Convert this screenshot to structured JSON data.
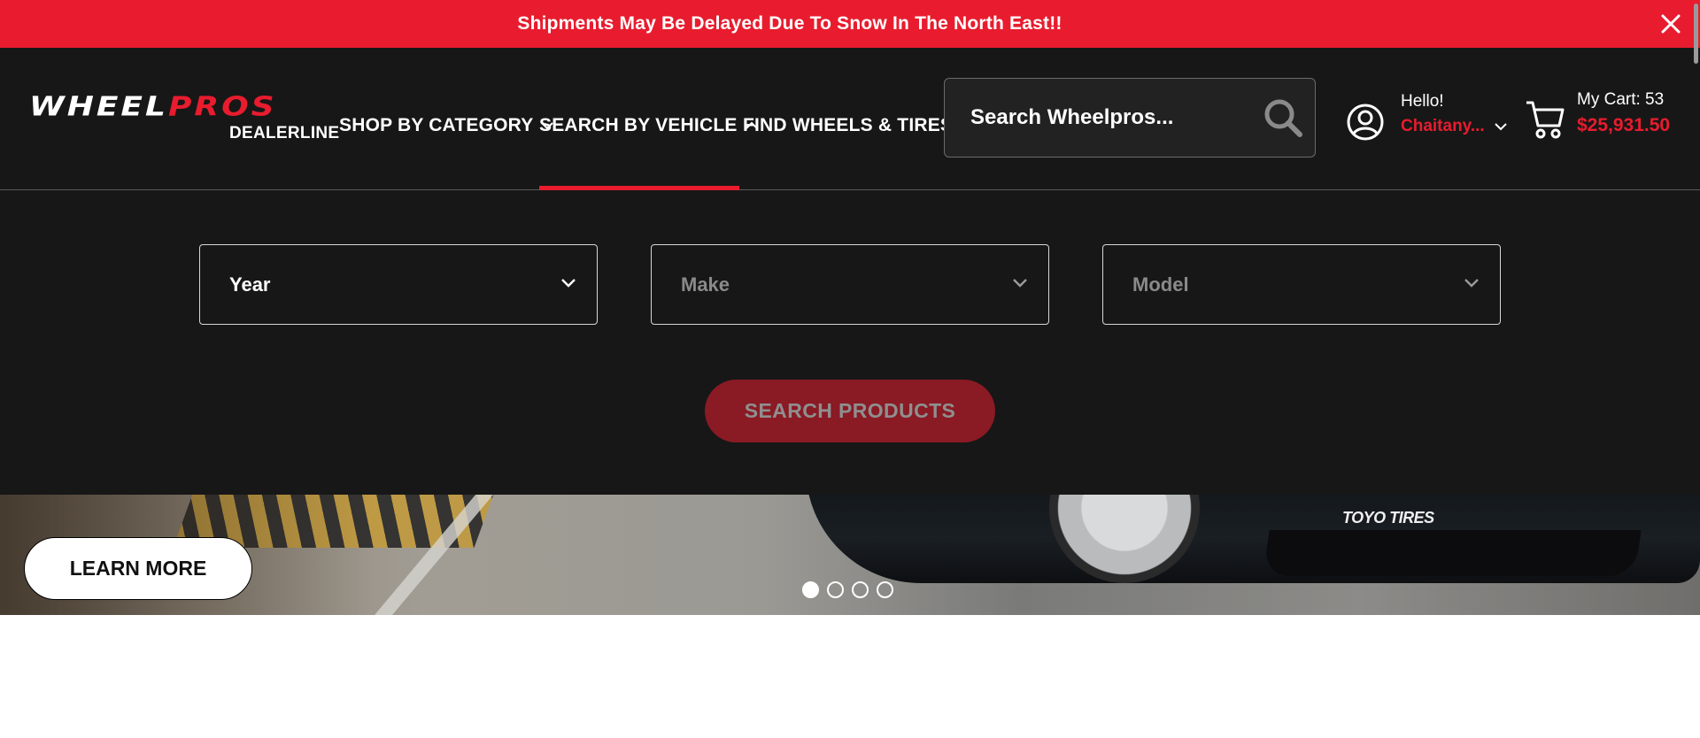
{
  "announcement": {
    "text": "Shipments May Be Delayed Due To Snow In The North East!!",
    "close_icon": "close-icon"
  },
  "brand": {
    "logo_word_1": "WHEEL",
    "logo_word_2": "PROS",
    "logo_sub": "DEALERLINE",
    "accent_color": "#e81c2e"
  },
  "nav": {
    "items": [
      {
        "label": "SHOP BY CATEGORY",
        "chevron": "chevron-down-icon"
      },
      {
        "label": "SEARCH BY VEHICLE",
        "chevron": "chevron-up-icon",
        "active": true
      },
      {
        "label": "FIND WHEELS & TIRES"
      }
    ]
  },
  "search": {
    "placeholder": "Search Wheelpros...",
    "icon": "search-icon"
  },
  "account": {
    "greeting": "Hello!",
    "name": "Chaitany...",
    "icon": "user-icon"
  },
  "cart": {
    "label": "My Cart: 53",
    "total": "$25,931.50",
    "icon": "cart-icon"
  },
  "vehicle_search": {
    "year_label": "Year",
    "make_label": "Make",
    "model_label": "Model",
    "submit_label": "SEARCH PRODUCTS"
  },
  "hero": {
    "cta_label": "LEARN MORE",
    "brand_text": "TOYO TIRES",
    "slides_count": 4,
    "active_slide": 1
  }
}
